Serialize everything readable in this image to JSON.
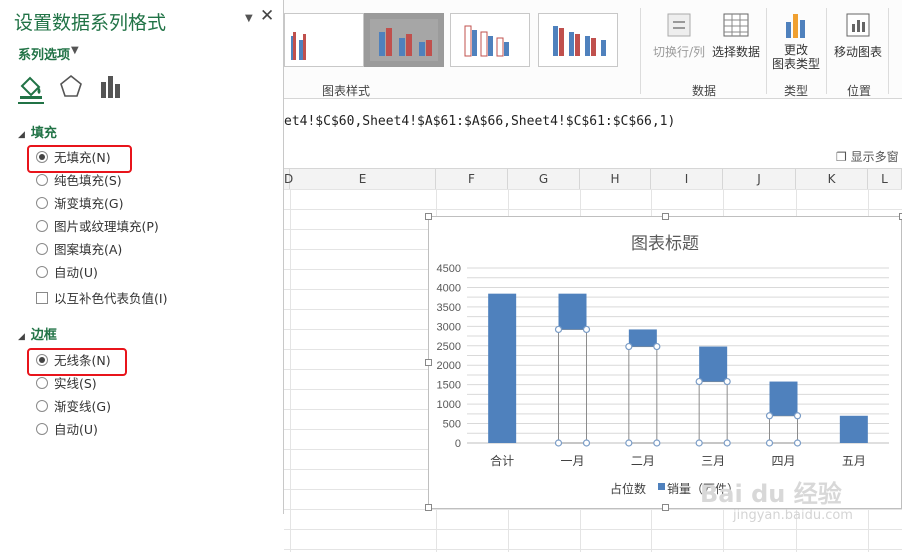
{
  "pane": {
    "title": "设置数据系列格式",
    "series_options": "系列选项",
    "fill_section": "填充",
    "fill_options": [
      {
        "label": "无填充(N)",
        "selected": true
      },
      {
        "label": "纯色填充(S)",
        "selected": false
      },
      {
        "label": "渐变填充(G)",
        "selected": false
      },
      {
        "label": "图片或纹理填充(P)",
        "selected": false
      },
      {
        "label": "图案填充(A)",
        "selected": false
      },
      {
        "label": "自动(U)",
        "selected": false
      }
    ],
    "invert_label": "以互补色代表负值(I)",
    "border_section": "边框",
    "border_options": [
      {
        "label": "无线条(N)",
        "selected": true
      },
      {
        "label": "实线(S)",
        "selected": false
      },
      {
        "label": "渐变线(G)",
        "selected": false
      },
      {
        "label": "自动(U)",
        "selected": false
      }
    ]
  },
  "ribbon": {
    "chart_styles_label": "图表样式",
    "switch_row_col": "切换行/列",
    "select_data": "选择数据",
    "data_group": "数据",
    "change_type": "更改\n图表类型",
    "type_group": "类型",
    "move_chart": "移动图表",
    "location_group": "位置"
  },
  "formula": "et4!$C$60,Sheet4!$A$61:$A$66,Sheet4!$C$61:$C$66,1)",
  "sheet": {
    "show_multi": "显示多窗",
    "columns": [
      "D",
      "E",
      "F",
      "G",
      "H",
      "I",
      "J",
      "K",
      "L"
    ]
  },
  "chart_data": {
    "type": "bar",
    "title": "图表标题",
    "categories": [
      "合计",
      "一月",
      "二月",
      "三月",
      "四月",
      "五月"
    ],
    "series": [
      {
        "name": "占位数",
        "values": [
          0,
          2920,
          2480,
          1580,
          700,
          0
        ],
        "color": "none"
      },
      {
        "name": "销量（万件）",
        "values": [
          3840,
          920,
          440,
          900,
          880,
          700
        ],
        "color": "#4f81bd"
      }
    ],
    "ylim": [
      0,
      4500
    ],
    "yticks": [
      0,
      250,
      500,
      750,
      1000,
      1250,
      1500,
      1750,
      2000,
      2250,
      2500,
      2750,
      3000,
      3250,
      3500,
      3750,
      4000,
      4250,
      4500
    ],
    "ytick_labels": [
      "0",
      "500",
      "1000",
      "1500",
      "2000",
      "2500",
      "3000",
      "3500",
      "4000",
      "4500"
    ],
    "legend": "bottom",
    "grid": true
  },
  "watermark": {
    "brand": "Bai du 经验",
    "url": "jingyan.baidu.com"
  }
}
